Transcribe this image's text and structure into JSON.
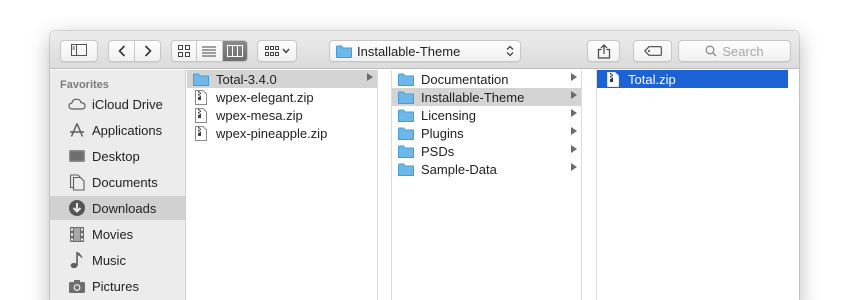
{
  "toolbar": {
    "path_label": "Installable-Theme",
    "search_placeholder": "Search"
  },
  "sidebar": {
    "section_title": "Favorites",
    "items": [
      {
        "label": "iCloud Drive",
        "icon": "cloud-icon"
      },
      {
        "label": "Applications",
        "icon": "applications-icon"
      },
      {
        "label": "Desktop",
        "icon": "desktop-icon"
      },
      {
        "label": "Documents",
        "icon": "documents-icon"
      },
      {
        "label": "Downloads",
        "icon": "downloads-icon",
        "selected": true
      },
      {
        "label": "Movies",
        "icon": "movies-icon"
      },
      {
        "label": "Music",
        "icon": "music-icon"
      },
      {
        "label": "Pictures",
        "icon": "pictures-icon"
      }
    ]
  },
  "columns": [
    {
      "items": [
        {
          "label": "Total-3.4.0",
          "kind": "folder",
          "state": "path"
        },
        {
          "label": "wpex-elegant.zip",
          "kind": "zip"
        },
        {
          "label": "wpex-mesa.zip",
          "kind": "zip"
        },
        {
          "label": "wpex-pineapple.zip",
          "kind": "zip"
        }
      ]
    },
    {
      "items": [
        {
          "label": "Documentation",
          "kind": "folder"
        },
        {
          "label": "Installable-Theme",
          "kind": "folder",
          "state": "path"
        },
        {
          "label": "Licensing",
          "kind": "folder"
        },
        {
          "label": "Plugins",
          "kind": "folder"
        },
        {
          "label": "PSDs",
          "kind": "folder"
        },
        {
          "label": "Sample-Data",
          "kind": "folder"
        }
      ]
    },
    {
      "items": [
        {
          "label": "Total.zip",
          "kind": "zip",
          "state": "selected"
        }
      ]
    }
  ],
  "colors": {
    "selection": "#1b62d6",
    "folder": "#6db8ea",
    "path_highlight": "#d4d4d4"
  }
}
